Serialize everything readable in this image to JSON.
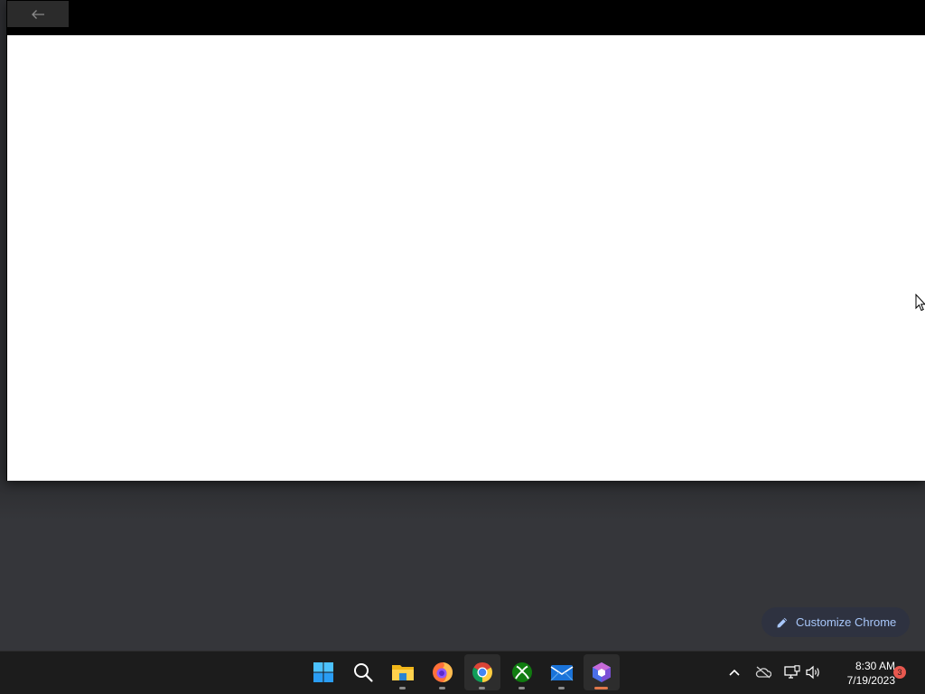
{
  "window": {
    "back_icon": "back-arrow-icon"
  },
  "chrome": {
    "customize_label": "Customize Chrome",
    "customize_icon": "pencil-icon",
    "accent": "#a8c7fa"
  },
  "taskbar": {
    "apps": [
      {
        "name": "Start",
        "icon": "windows-start-icon"
      },
      {
        "name": "Search",
        "icon": "search-icon"
      },
      {
        "name": "File Explorer",
        "icon": "folder-icon"
      },
      {
        "name": "Firefox",
        "icon": "firefox-icon"
      },
      {
        "name": "Chrome",
        "icon": "chrome-icon"
      },
      {
        "name": "Xbox",
        "icon": "xbox-icon"
      },
      {
        "name": "Mail",
        "icon": "mail-icon"
      },
      {
        "name": "App",
        "icon": "cube-app-icon"
      }
    ],
    "tray": {
      "icons": [
        "chevron-up-icon",
        "onedrive-offline-icon",
        "network-icon",
        "volume-icon"
      ],
      "time": "8:30 AM",
      "date": "7/19/2023",
      "notification_count": "3"
    }
  }
}
